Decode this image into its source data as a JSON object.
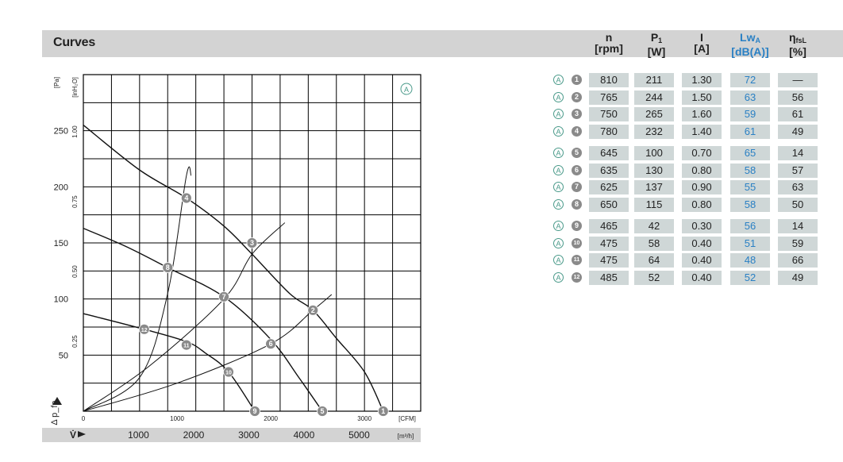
{
  "header": {
    "title": "Curves"
  },
  "table": {
    "columns": [
      {
        "key": "n",
        "label": "n",
        "unit": "[rpm]"
      },
      {
        "key": "p1",
        "label": "P",
        "sub": "1",
        "unit": "[W]"
      },
      {
        "key": "i",
        "label": "I",
        "unit": "[A]"
      },
      {
        "key": "lw",
        "label": "Lw",
        "sub": "A",
        "unit": "[dB(A)]"
      },
      {
        "key": "eta",
        "label": "η",
        "sub": "fsL",
        "unit": "[%]"
      }
    ],
    "rows": [
      {
        "mark": "A",
        "no": "1",
        "n": "810",
        "p1": "211",
        "i": "1.30",
        "lw": "72",
        "eta": "—"
      },
      {
        "mark": "A",
        "no": "2",
        "n": "765",
        "p1": "244",
        "i": "1.50",
        "lw": "63",
        "eta": "56"
      },
      {
        "mark": "A",
        "no": "3",
        "n": "750",
        "p1": "265",
        "i": "1.60",
        "lw": "59",
        "eta": "61"
      },
      {
        "mark": "A",
        "no": "4",
        "n": "780",
        "p1": "232",
        "i": "1.40",
        "lw": "61",
        "eta": "49"
      },
      {
        "mark": "A",
        "no": "5",
        "n": "645",
        "p1": "100",
        "i": "0.70",
        "lw": "65",
        "eta": "14"
      },
      {
        "mark": "A",
        "no": "6",
        "n": "635",
        "p1": "130",
        "i": "0.80",
        "lw": "58",
        "eta": "57"
      },
      {
        "mark": "A",
        "no": "7",
        "n": "625",
        "p1": "137",
        "i": "0.90",
        "lw": "55",
        "eta": "63"
      },
      {
        "mark": "A",
        "no": "8",
        "n": "650",
        "p1": "115",
        "i": "0.80",
        "lw": "58",
        "eta": "50"
      },
      {
        "mark": "A",
        "no": "9",
        "n": "465",
        "p1": "42",
        "i": "0.30",
        "lw": "56",
        "eta": "14"
      },
      {
        "mark": "A",
        "no": "10",
        "n": "475",
        "p1": "58",
        "i": "0.40",
        "lw": "51",
        "eta": "59"
      },
      {
        "mark": "A",
        "no": "11",
        "n": "475",
        "p1": "64",
        "i": "0.40",
        "lw": "48",
        "eta": "66"
      },
      {
        "mark": "A",
        "no": "12",
        "n": "485",
        "p1": "52",
        "i": "0.40",
        "lw": "52",
        "eta": "49"
      }
    ]
  },
  "colors": {
    "accent": "#2a80c4",
    "header_bg": "#d3d3d3",
    "cell_bg": "#cfd7d7",
    "marker": "#8a8a8a",
    "mark_a": "#4a9a8a"
  },
  "chart_data": {
    "type": "line",
    "curve_label": "A",
    "xlabel": "V̇",
    "ylabel": "Δ p_fa",
    "x_unit": "[CFM]",
    "x2_unit": "[m³/h]",
    "y_unit": "[Pa]",
    "y2_unit": "[inH₂O]",
    "xlim": [
      0,
      3600
    ],
    "ylim": [
      0,
      300
    ],
    "grid": true,
    "x_ticks": [
      "0",
      "1000",
      "2000",
      "3000"
    ],
    "x2_ticks": [
      "1000",
      "2000",
      "3000",
      "4000",
      "5000"
    ],
    "y_ticks": [
      "50",
      "100",
      "150",
      "200",
      "250"
    ],
    "y2_ticks": [
      "0.25",
      "0.50",
      "0.75",
      "1.00"
    ],
    "series": [
      {
        "points": [
          [
            0,
            255
          ],
          [
            600,
            215
          ],
          [
            1100,
            190
          ],
          [
            1500,
            165
          ],
          [
            1800,
            140
          ],
          [
            2200,
            105
          ],
          [
            2450,
            90
          ],
          [
            2700,
            65
          ],
          [
            3000,
            35
          ],
          [
            3200,
            0
          ]
        ]
      },
      {
        "points": [
          [
            0,
            163
          ],
          [
            450,
            147
          ],
          [
            900,
            128
          ],
          [
            1500,
            102
          ],
          [
            2000,
            64
          ],
          [
            2300,
            30
          ],
          [
            2550,
            0
          ]
        ]
      },
      {
        "points": [
          [
            0,
            87
          ],
          [
            650,
            73
          ],
          [
            1100,
            62
          ],
          [
            1300,
            52
          ],
          [
            1550,
            35
          ],
          [
            1830,
            0
          ]
        ]
      },
      {
        "points": [
          [
            0,
            0
          ],
          [
            600,
            30
          ],
          [
            900,
            105
          ],
          [
            1100,
            210
          ],
          [
            1150,
            210
          ]
        ]
      },
      {
        "points": [
          [
            0,
            0
          ],
          [
            700,
            40
          ],
          [
            1500,
            100
          ],
          [
            1800,
            140
          ],
          [
            2150,
            168
          ]
        ]
      },
      {
        "points": [
          [
            0,
            0
          ],
          [
            1000,
            25
          ],
          [
            2000,
            60
          ],
          [
            2450,
            90
          ],
          [
            2650,
            104
          ]
        ]
      }
    ],
    "markers": [
      {
        "label": "1",
        "x": 3200,
        "y": 0
      },
      {
        "label": "2",
        "x": 2450,
        "y": 90
      },
      {
        "label": "3",
        "x": 1800,
        "y": 150
      },
      {
        "label": "4",
        "x": 1100,
        "y": 190
      },
      {
        "label": "5",
        "x": 2550,
        "y": 0
      },
      {
        "label": "6",
        "x": 2000,
        "y": 60
      },
      {
        "label": "7",
        "x": 1500,
        "y": 102
      },
      {
        "label": "8",
        "x": 900,
        "y": 128
      },
      {
        "label": "9",
        "x": 1830,
        "y": 0
      },
      {
        "label": "10",
        "x": 1550,
        "y": 35
      },
      {
        "label": "11",
        "x": 1100,
        "y": 59
      },
      {
        "label": "12",
        "x": 650,
        "y": 73
      }
    ]
  }
}
